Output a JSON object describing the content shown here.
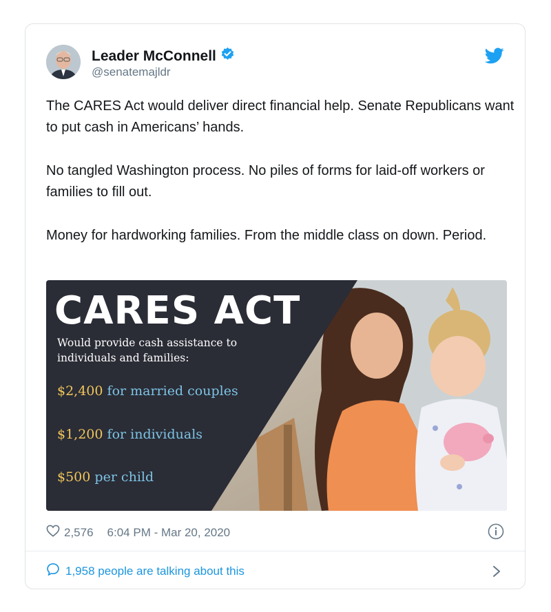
{
  "tweet": {
    "author_name": "Leader McConnell",
    "handle": "@senatemajldr",
    "paragraphs": [
      "The CARES Act would deliver direct financial help. Senate Republicans want to put cash in Americans’ hands.",
      "No tangled Washington process. No piles of forms for laid-off workers or families to fill out.",
      "Money for hardworking families. From the middle class on down. Period."
    ],
    "likes": "2,576",
    "timestamp": "6:04 PM - Mar 20, 2020",
    "talking": "1,958 people are talking about this"
  },
  "media": {
    "title": "CARES ACT",
    "subtitle": "Would provide cash assistance to individuals and families:",
    "items": [
      {
        "amount": "$2,400",
        "label": "for married couples"
      },
      {
        "amount": "$1,200",
        "label": "for individuals"
      },
      {
        "amount": "$500",
        "label": "per child"
      }
    ]
  },
  "colors": {
    "twitter_blue": "#1da1f2",
    "link_blue": "#1b95e0",
    "media_dark": "#2a2c36",
    "amount_yellow": "#f1c75a",
    "label_blue": "#7dc4e4"
  },
  "icons": [
    "verified-badge-icon",
    "twitter-bird-icon",
    "heart-icon",
    "info-icon",
    "speech-bubble-icon",
    "chevron-right-icon"
  ]
}
